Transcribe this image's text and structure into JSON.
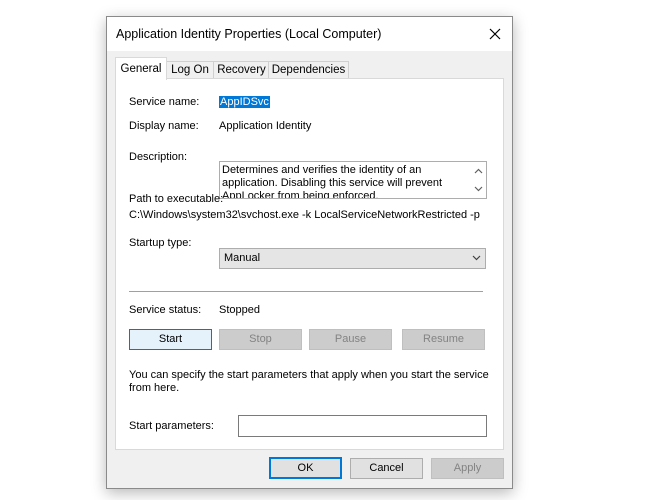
{
  "window": {
    "title": "Application Identity Properties (Local Computer)"
  },
  "tabs": [
    {
      "label": "General",
      "active": true
    },
    {
      "label": "Log On",
      "active": false
    },
    {
      "label": "Recovery",
      "active": false
    },
    {
      "label": "Dependencies",
      "active": false
    }
  ],
  "general": {
    "service_name_label": "Service name:",
    "service_name_value": "AppIDSvc",
    "display_name_label": "Display name:",
    "display_name_value": "Application Identity",
    "description_label": "Description:",
    "description_value": "Determines and verifies the identity of an application. Disabling this service will prevent AppLocker from being enforced.",
    "path_label": "Path to executable:",
    "path_value": "C:\\Windows\\system32\\svchost.exe -k LocalServiceNetworkRestricted -p",
    "startup_type_label": "Startup type:",
    "startup_type_value": "Manual",
    "service_status_label": "Service status:",
    "service_status_value": "Stopped",
    "start_button": "Start",
    "stop_button": "Stop",
    "pause_button": "Pause",
    "resume_button": "Resume",
    "start_params_help": "You can specify the start parameters that apply when you start the service from here.",
    "start_params_label": "Start parameters:",
    "start_params_value": ""
  },
  "footer": {
    "ok_button": "OK",
    "cancel_button": "Cancel",
    "apply_button": "Apply"
  },
  "icons": {
    "close": "close-icon",
    "scroll_up": "chevron-up-icon",
    "scroll_down": "chevron-down-icon",
    "dropdown": "chevron-down-icon"
  },
  "colors": {
    "accent": "#0078d7",
    "dialog_bg": "#f0f0f0",
    "panel_bg": "#ffffff",
    "disabled_text": "#838383"
  }
}
